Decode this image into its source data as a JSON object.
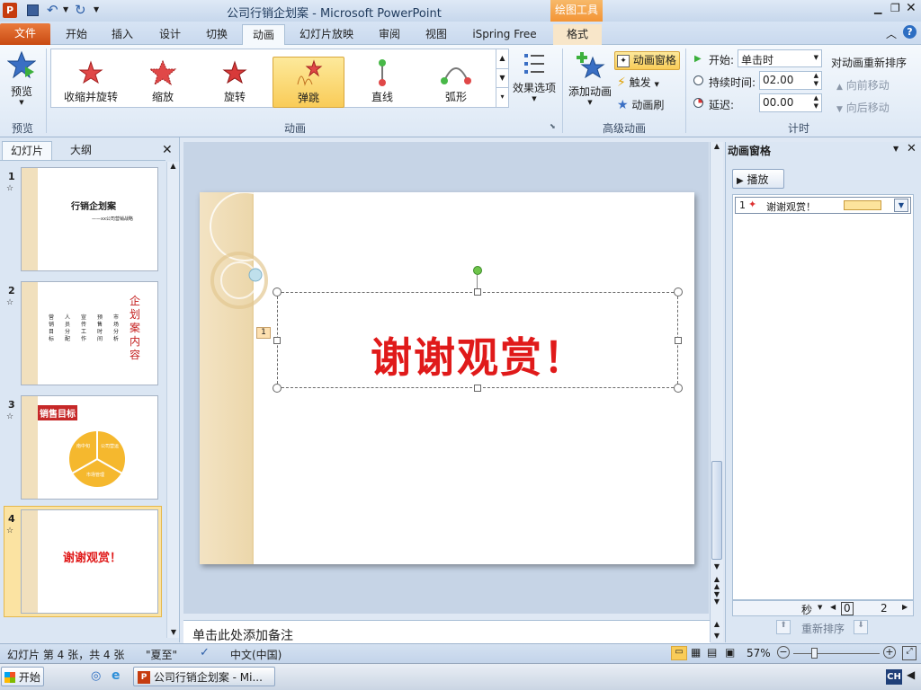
{
  "window": {
    "title": "公司行销企划案 - Microsoft PowerPoint",
    "context_tab_group": "绘图工具"
  },
  "tabs": [
    {
      "label": "文件"
    },
    {
      "label": "开始"
    },
    {
      "label": "插入"
    },
    {
      "label": "设计"
    },
    {
      "label": "切换"
    },
    {
      "label": "动画"
    },
    {
      "label": "幻灯片放映"
    },
    {
      "label": "审阅"
    },
    {
      "label": "视图"
    },
    {
      "label": "iSpring Free"
    },
    {
      "label": "格式"
    }
  ],
  "ribbon": {
    "preview_label": "预览",
    "preview_group": "预览",
    "animations": [
      {
        "label": "收缩并旋转"
      },
      {
        "label": "缩放"
      },
      {
        "label": "旋转"
      },
      {
        "label": "弹跳"
      },
      {
        "label": "直线"
      },
      {
        "label": "弧形"
      }
    ],
    "effect_options": "效果选项",
    "animation_group": "动画",
    "add_animation": "添加动画",
    "animation_pane_btn": "动画窗格",
    "trigger": "触发",
    "animation_painter": "动画刷",
    "advanced_group": "高级动画",
    "start_label": "开始:",
    "start_value": "单击时",
    "duration_label": "持续时间:",
    "duration_value": "02.00",
    "delay_label": "延迟:",
    "delay_value": "00.00",
    "timing_group": "计时",
    "reorder_title": "对动画重新排序",
    "move_earlier": "向前移动",
    "move_later": "向后移动"
  },
  "left_panel": {
    "tab_slides": "幻灯片",
    "tab_outline": "大纲",
    "slides": [
      {
        "num": "1",
        "title": "行销企划案",
        "subtitle": "——xx公司营销战略"
      },
      {
        "num": "2",
        "title": "企划案内容",
        "columns": [
          "营销目标",
          "人员分配",
          "宣传工作",
          "预售时间",
          "市场分析"
        ]
      },
      {
        "num": "3",
        "title": "销售目标",
        "segments": [
          "南中旬",
          "公司营运",
          "市场管理"
        ]
      },
      {
        "num": "4",
        "title": "谢谢观赏！"
      }
    ]
  },
  "slide": {
    "main_text": "谢谢观赏！",
    "anim_tag": "1"
  },
  "notes_placeholder": "单击此处添加备注",
  "anim_pane": {
    "title": "动画窗格",
    "play": "播放",
    "items": [
      {
        "num": "1",
        "label": "谢谢观赏！"
      }
    ],
    "timeline_unit": "秒",
    "timeline_start": "0",
    "timeline_end": "2",
    "reorder_label": "重新排序"
  },
  "status": {
    "slide_info": "幻灯片 第 4 张，共 4 张",
    "theme": "\"夏至\"",
    "language": "中文(中国)",
    "zoom": "57%"
  },
  "taskbar": {
    "start": "开始",
    "window_item": "公司行销企划案 - Mi...",
    "ime": "CH"
  },
  "colors": {
    "file_tab": "#d35a1c",
    "selected_item": "#f9cc58",
    "slide_text": "#e01a1a",
    "theme_strip": "#f1e0bd"
  }
}
